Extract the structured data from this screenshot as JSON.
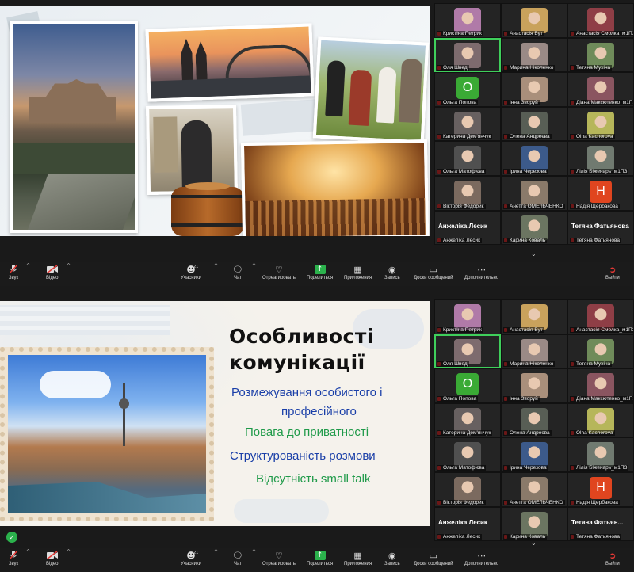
{
  "participants_top": [
    {
      "name": "Кристіна Петрик",
      "kind": "video",
      "bg": "#b07aa8"
    },
    {
      "name": "Анастасія Бут",
      "kind": "video",
      "bg": "#c9a25c"
    },
    {
      "name": "Анастасія Смолка_м1ПЗ",
      "kind": "video",
      "bg": "#8f3e46"
    },
    {
      "name": "Оля Швед",
      "kind": "video",
      "bg": "#7d6b6e",
      "active": true
    },
    {
      "name": "Марина Ніколенко",
      "kind": "video",
      "bg": "#9a8a86"
    },
    {
      "name": "Тетяна Мухіна",
      "kind": "video",
      "bg": "#6f8b5a"
    },
    {
      "name": "Ольга Попова",
      "kind": "avatar",
      "letter": "O",
      "color": "#3aaa35"
    },
    {
      "name": "Інна Зворуй",
      "kind": "video",
      "bg": "#a98f7b"
    },
    {
      "name": "Діана Максютенко_м1ПЗ",
      "kind": "video",
      "bg": "#8a5560"
    },
    {
      "name": "Катерина Дем'янчук",
      "kind": "video",
      "bg": "#676060"
    },
    {
      "name": "Олена Андреєва",
      "kind": "video",
      "bg": "#585e55"
    },
    {
      "name": "Olha Kachorova",
      "kind": "video",
      "bg": "#b6b65a"
    },
    {
      "name": "Ольга Матофієва",
      "kind": "video",
      "bg": "#505050"
    },
    {
      "name": "Ірина Черезова",
      "kind": "video",
      "bg": "#3c5a8a"
    },
    {
      "name": "Лілія Біженарь_м1ПЗ",
      "kind": "video",
      "bg": "#707a70"
    },
    {
      "name": "Вікторія Федорик",
      "kind": "video",
      "bg": "#7b6a5f"
    },
    {
      "name": "Анетта ОМЕЛЬЧЕНКО",
      "kind": "video",
      "bg": "#8a7a6a"
    },
    {
      "name": "Надія Щербакова",
      "kind": "avatar",
      "letter": "H",
      "color": "#e0451f"
    },
    {
      "name": "Анжеліка Лесик",
      "kind": "text",
      "label": "Анжеліка Лесик"
    },
    {
      "name": "Карина Коваль",
      "kind": "video",
      "bg": "#6b7561"
    },
    {
      "name": "Тетяна Фатьянова",
      "kind": "text",
      "label": "Тетяна Фатьянова"
    }
  ],
  "participants_bottom": [
    {
      "name": "Кристіна Петрик",
      "kind": "video",
      "bg": "#b07aa8"
    },
    {
      "name": "Анастасія Бут",
      "kind": "video",
      "bg": "#c9a25c"
    },
    {
      "name": "Анастасія Смолка_м1ПЗ",
      "kind": "video",
      "bg": "#8f3e46"
    },
    {
      "name": "Оля Швед",
      "kind": "video",
      "bg": "#7d6b6e",
      "active": true
    },
    {
      "name": "Марина Ніколенко",
      "kind": "video",
      "bg": "#9a8a86"
    },
    {
      "name": "Тетяна Мухіна",
      "kind": "video",
      "bg": "#6f8b5a"
    },
    {
      "name": "Ольга Попова",
      "kind": "avatar",
      "letter": "O",
      "color": "#3aaa35"
    },
    {
      "name": "Інна Зворуй",
      "kind": "video",
      "bg": "#a98f7b"
    },
    {
      "name": "Діана Максютенко_м1ПЗ",
      "kind": "video",
      "bg": "#8a5560"
    },
    {
      "name": "Катерина Дем'янчук",
      "kind": "video",
      "bg": "#676060"
    },
    {
      "name": "Олена Андреєва",
      "kind": "video",
      "bg": "#585e55"
    },
    {
      "name": "Olha Kachorova",
      "kind": "video",
      "bg": "#b6b65a"
    },
    {
      "name": "Ольга Матофієва",
      "kind": "video",
      "bg": "#505050"
    },
    {
      "name": "Ірина Черезова",
      "kind": "video",
      "bg": "#3c5a8a"
    },
    {
      "name": "Лілія Біженарь_м1ПЗ",
      "kind": "video",
      "bg": "#707a70"
    },
    {
      "name": "Вікторія Федорик",
      "kind": "video",
      "bg": "#7b6a5f"
    },
    {
      "name": "Анетта ОМЕЛЬЧЕНКО",
      "kind": "video",
      "bg": "#8a7a6a"
    },
    {
      "name": "Надія Щербакова",
      "kind": "avatar",
      "letter": "H",
      "color": "#e0451f"
    },
    {
      "name": "Анжеліка Лесик",
      "kind": "text",
      "label": "Анжеліка Лесик"
    },
    {
      "name": "Карина Коваль",
      "kind": "video",
      "bg": "#6b7561"
    },
    {
      "name": "Тетяна Фатьянова",
      "kind": "text",
      "label": "Тетяна Фатьян..."
    }
  ],
  "toolbar": {
    "audio": "Звук",
    "video": "Відео",
    "participants": "Учасники",
    "participants_count": "21",
    "chat": "Чат",
    "react": "Отреагировать",
    "share": "Поделиться",
    "apps": "Приложения",
    "record": "Запись",
    "whiteboards": "Доски сообщений",
    "more": "Дополнительно",
    "leave": "Выйти"
  },
  "slide2": {
    "title_line1": "Особливості",
    "title_line2": "комунікації",
    "bullets": [
      {
        "text": "Розмежування особистого і",
        "color": "#1a3fa8"
      },
      {
        "text": "професійного",
        "color": "#1a3fa8"
      },
      {
        "text": "Повага до приватності",
        "color": "#1f9a49"
      },
      {
        "text": "Структурованість розмови",
        "color": "#1a3fa8"
      },
      {
        "text": "Відсутність small talk",
        "color": "#1f9a49"
      }
    ]
  },
  "colors": {
    "active_speaker": "#3fcf5b",
    "share_green": "#2bb24c",
    "leave_red": "#e53935"
  }
}
